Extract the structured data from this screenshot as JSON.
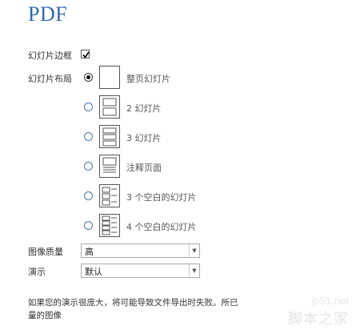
{
  "title": "PDF",
  "slide_border": {
    "label": "幻灯片边框",
    "checked": true
  },
  "layout": {
    "label": "幻灯片布局",
    "options": [
      {
        "label": "整页幻灯片",
        "thumb": "full-slide-icon",
        "selected": true
      },
      {
        "label": "2 幻灯片",
        "thumb": "two-slides-icon",
        "selected": false
      },
      {
        "label": "3 幻灯片",
        "thumb": "three-slides-icon",
        "selected": false
      },
      {
        "label": "注释页面",
        "thumb": "notes-page-icon",
        "selected": false
      },
      {
        "label": "3 个空白的幻灯片",
        "thumb": "three-blank-slides-icon",
        "selected": false
      },
      {
        "label": "4 个空白的幻灯片",
        "thumb": "four-blank-slides-icon",
        "selected": false
      }
    ]
  },
  "image_quality": {
    "label": "图像质量",
    "value": "高"
  },
  "presentation": {
    "label": "演示",
    "value": "默认"
  },
  "note": {
    "line1": "如果您的演示很庞大，将可能导致文件导出时失败。所已",
    "line2": "量的图像"
  },
  "watermark": {
    "site": "jb51.net",
    "name": "脚本之家"
  },
  "colors": {
    "title": "#2e6ab3",
    "radio_border": "#4a78b0"
  }
}
